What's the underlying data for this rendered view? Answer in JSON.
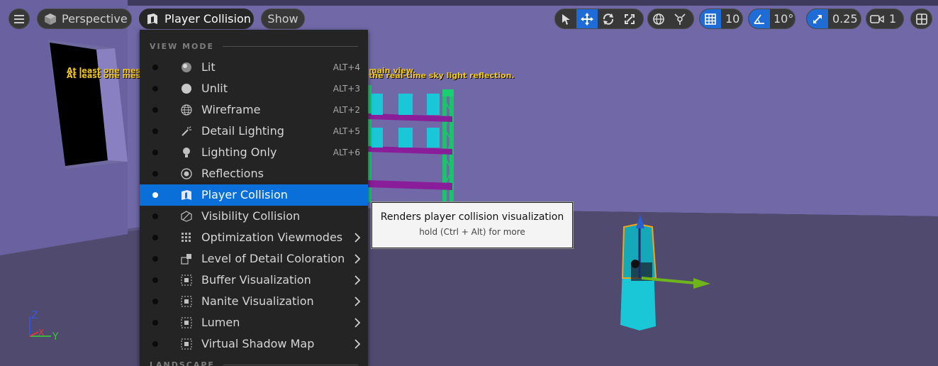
{
  "toolbar": {
    "perspective_label": "Perspective",
    "viewmode_label": "Player Collision",
    "show_label": "Show",
    "grid_snap_value": "10",
    "rotation_snap_value": "10°",
    "scale_snap_value": "0.25",
    "camera_speed_value": "1",
    "icons": [
      "hamburger-menu-icon",
      "cube-icon",
      "collision-mode-icon",
      "select-arrow-icon",
      "move-icon",
      "rotate-icon",
      "scale-icon",
      "world-globe-icon",
      "surface-snap-icon",
      "grid-icon",
      "angle-icon",
      "scale-snap-icon",
      "camera-icon",
      "layout-icon"
    ],
    "accent_color": "#1f6cd6"
  },
  "viewport": {
    "warning_left": "At least one mesh",
    "warning_right_1": "main view.",
    "warning_right_2": "the real-time sky light reflection.",
    "axis_z": "Z",
    "axis_x": "X",
    "axis_y": "Y"
  },
  "menu": {
    "section_view_mode": "VIEW MODE",
    "section_landscape": "LANDSCAPE",
    "selection_color": "#0a6fd8",
    "items": [
      {
        "label": "Lit",
        "shortcut": "ALT+4",
        "icon": "lit-sphere-icon"
      },
      {
        "label": "Unlit",
        "shortcut": "ALT+3",
        "icon": "unlit-sphere-icon"
      },
      {
        "label": "Wireframe",
        "shortcut": "ALT+2",
        "icon": "wireframe-globe-icon"
      },
      {
        "label": "Detail Lighting",
        "shortcut": "ALT+5",
        "icon": "detail-lighting-icon"
      },
      {
        "label": "Lighting Only",
        "shortcut": "ALT+6",
        "icon": "bulb-icon"
      },
      {
        "label": "Reflections",
        "shortcut": "",
        "icon": "reflections-icon"
      },
      {
        "label": "Player Collision",
        "shortcut": "",
        "icon": "player-collision-icon"
      },
      {
        "label": "Visibility Collision",
        "shortcut": "",
        "icon": "visibility-collision-icon"
      },
      {
        "label": "Optimization Viewmodes",
        "shortcut": "",
        "icon": "optimization-grid-icon"
      },
      {
        "label": "Level of Detail Coloration",
        "shortcut": "",
        "icon": "lod-icon"
      },
      {
        "label": "Buffer Visualization",
        "shortcut": "",
        "icon": "buffer-icon"
      },
      {
        "label": "Nanite Visualization",
        "shortcut": "",
        "icon": "nanite-icon"
      },
      {
        "label": "Lumen",
        "shortcut": "",
        "icon": "lumen-icon"
      },
      {
        "label": "Virtual Shadow Map",
        "shortcut": "",
        "icon": "vsm-icon"
      }
    ]
  },
  "tooltip": {
    "title": "Renders player collision visualization",
    "hint": "hold (Ctrl + Alt) for more"
  }
}
